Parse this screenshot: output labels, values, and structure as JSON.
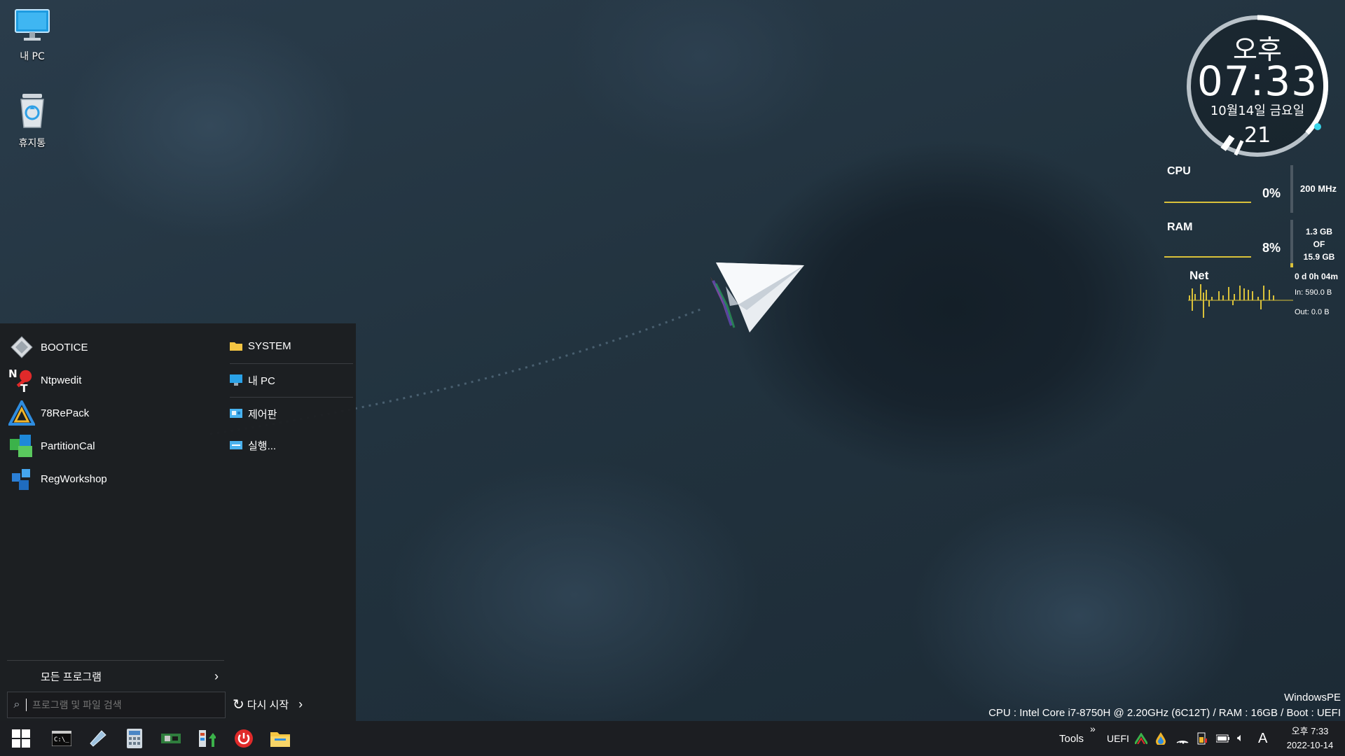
{
  "desktop": {
    "icons": [
      {
        "label": "내 PC",
        "icon": "monitor-icon"
      },
      {
        "label": "휴지통",
        "icon": "recycle-bin-icon"
      }
    ]
  },
  "clock_widget": {
    "ampm": "오후",
    "time": "07:33",
    "date": "10월14일 금요일",
    "seconds": "21"
  },
  "system_monitor": {
    "cpu_label": "CPU",
    "cpu_percent": "0%",
    "cpu_freq": "200 MHz",
    "ram_label": "RAM",
    "ram_percent": "8%",
    "ram_used": "1.3 GB",
    "ram_of": "OF",
    "ram_total": "15.9 GB",
    "net_label": "Net",
    "uptime": "0 d 0h 04m",
    "net_in": "In: 590.0 B",
    "net_out": "Out: 0.0 B"
  },
  "start_menu": {
    "pinned": [
      {
        "label": "BOOTICE",
        "icon": "bootice-icon"
      },
      {
        "label": "Ntpwedit",
        "icon": "ntpwedit-icon"
      },
      {
        "label": "78RePack",
        "icon": "78repack-icon"
      },
      {
        "label": "PartitionCal",
        "icon": "partitioncal-icon"
      },
      {
        "label": "RegWorkshop",
        "icon": "regworkshop-icon"
      }
    ],
    "quick_links": [
      {
        "label": "SYSTEM",
        "icon": "folder-icon"
      },
      {
        "label": "내 PC",
        "icon": "computer-icon"
      },
      {
        "label": "제어판",
        "icon": "control-panel-icon"
      },
      {
        "label": "실행...",
        "icon": "run-icon"
      }
    ],
    "all_programs": "모든 프로그램",
    "search_placeholder": "프로그램 및 파일 검색",
    "restart": "다시 시작"
  },
  "taskbar": {
    "buttons": [
      "windows-start-icon",
      "cmd-icon",
      "pen-drive-icon",
      "calculator-icon",
      "hardware-icon",
      "installer-icon",
      "power-icon",
      "file-explorer-icon"
    ],
    "tools": "Tools",
    "uefi": "UEFI",
    "ime": "A",
    "time": "오후 7:33",
    "date": "2022-10-14"
  },
  "watermark": {
    "title": "WindowsPE",
    "sysinfo": "CPU : Intel Core i7-8750H @ 2.20GHz (6C12T) / RAM : 16GB / Boot : UEFI"
  },
  "colors": {
    "accent_cyan": "#37d4e8",
    "graph_yellow": "#d9c13a",
    "menu_bg": "#1c1e21",
    "power_red": "#e02a2a"
  }
}
